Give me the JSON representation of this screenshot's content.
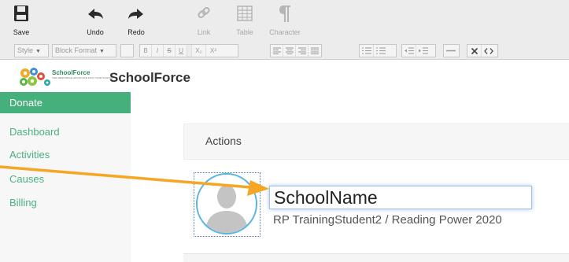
{
  "toolbar": {
    "save_label": "Save",
    "undo_label": "Undo",
    "redo_label": "Redo",
    "link_label": "Link",
    "table_label": "Table",
    "character_label": "Character",
    "style_select": "Style",
    "block_format_select": "Block Format",
    "mini_buttons": {
      "bold": "B",
      "italic": "I",
      "strike": "S",
      "underline": "U",
      "subscript": "X₂",
      "superscript": "X²"
    }
  },
  "app": {
    "logo_name": "SchoolForce",
    "logo_sub": "THE RESOURCE ADVOCATE FOR YOUR SCHOOL",
    "brand": "SchoolForce"
  },
  "sidebar": {
    "items": [
      {
        "label": "Donate",
        "active": true
      },
      {
        "label": "Dashboard",
        "active": false
      },
      {
        "label": "Activities",
        "active": false
      },
      {
        "label": "Causes",
        "active": false
      },
      {
        "label": "Billing",
        "active": false
      }
    ]
  },
  "main": {
    "panel_title": "Actions",
    "school_name": "SchoolName",
    "subline": "RP TrainingStudent2 / Reading Power 2020"
  },
  "colors": {
    "accent": "#45b07c",
    "annotation_arrow": "#f5a623",
    "focus_ring": "#9fc3ee"
  }
}
